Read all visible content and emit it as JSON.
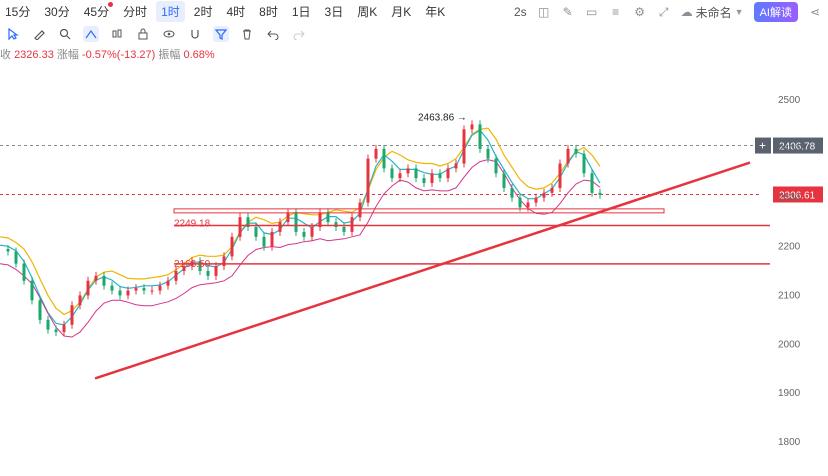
{
  "toolbar": {
    "periods": [
      "15分",
      "30分",
      "45分",
      "分时",
      "1时",
      "2时",
      "4时",
      "8时",
      "1日",
      "3日",
      "周K",
      "月K",
      "年K"
    ],
    "active_period": "1时",
    "refresh": "2s",
    "layout_name": "未命名",
    "ai_label": "AI解读"
  },
  "info": {
    "close_label": "收",
    "close": "2326.33",
    "change_label": "涨幅",
    "change": "-0.57%(-13.27)",
    "amplitude_label": "振幅",
    "amplitude": "0.68%"
  },
  "colors": {
    "up": "#e5343f",
    "down": "#1aa86b",
    "ma_yellow": "#f0b400",
    "ma_cyan": "#25b5c9",
    "ma_magenta": "#d3368a",
    "accent": "#2f6bff"
  },
  "chart_data": {
    "type": "line",
    "yticks": [
      2500,
      2400,
      2300,
      2200,
      2100,
      2000,
      1900,
      1800
    ],
    "ylim": [
      1780,
      2550
    ],
    "price_label": "2306.61",
    "crosshair_label": "2406.78",
    "high_label": "2463.86",
    "level_labels": [
      "2249.18",
      "2166.50"
    ],
    "series": [
      {
        "values": [
          2195,
          2190,
          2165,
          2130,
          2090,
          2050,
          2030,
          2025,
          2040,
          2080,
          2100,
          2130,
          2140,
          2120,
          2110,
          2100,
          2110,
          2115,
          2110,
          2110,
          2120,
          2130,
          2150,
          2160,
          2170,
          2150,
          2140,
          2160,
          2180,
          2220,
          2260,
          2240,
          2220,
          2200,
          2230,
          2250,
          2270,
          2230,
          2220,
          2240,
          2270,
          2250,
          2240,
          2230,
          2260,
          2290,
          2380,
          2400,
          2360,
          2340,
          2350,
          2360,
          2340,
          2330,
          2350,
          2340,
          2360,
          2370,
          2440,
          2450,
          2400,
          2380,
          2350,
          2320,
          2300,
          2280,
          2290,
          2300,
          2310,
          2320,
          2370,
          2400,
          2390,
          2350,
          2310,
          2306
        ]
      }
    ]
  }
}
